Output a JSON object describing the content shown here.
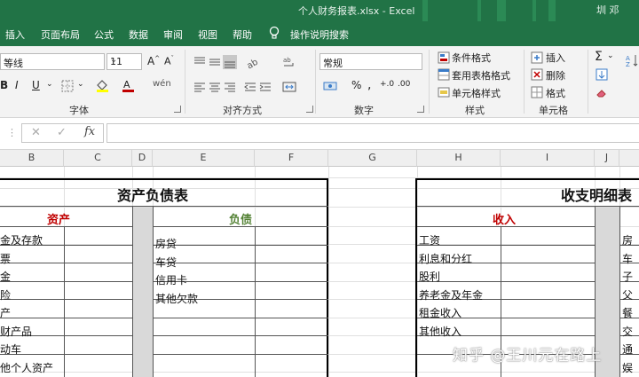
{
  "window": {
    "title": "个人财务报表.xlsx  -  Excel",
    "user": "圳 邓"
  },
  "tabs": [
    "插入",
    "页面布局",
    "公式",
    "数据",
    "审阅",
    "视图",
    "帮助"
  ],
  "tell_me": "操作说明搜索",
  "ribbon": {
    "font_name": "等线",
    "font_size": "11",
    "number_format": "常规",
    "styles": {
      "conditional": "条件格式",
      "as_table": "套用表格格式",
      "cell_styles": "单元格样式"
    },
    "cells_group": {
      "insert": "插入",
      "delete": "删除",
      "format": "格式"
    },
    "groups": {
      "font": "字体",
      "alignment": "对齐方式",
      "number": "数字",
      "styles": "样式",
      "cells": "单元格"
    },
    "colors": {
      "highlight": "#ffff00",
      "font_color": "#c00000",
      "brand": "#217346"
    }
  },
  "formula_bar": {
    "fx": "fx",
    "value": ""
  },
  "columns": [
    "B",
    "C",
    "D",
    "E",
    "F",
    "G",
    "H",
    "I",
    "J"
  ],
  "sheet": {
    "balance": {
      "title": "资产负债表",
      "assets_header": "资产",
      "liabilities_header": "负债",
      "assets": [
        "金及存款",
        "票",
        "金",
        "险",
        "产",
        "财产品",
        "动车",
        "他个人资产"
      ],
      "liabilities": [
        "房贷",
        "车贷",
        "信用卡",
        "其他欠款"
      ]
    },
    "income": {
      "title": "收支明细表",
      "income_header": "收入",
      "income_items": [
        "工资",
        "利息和分红",
        "股利",
        "养老金及年金",
        "租金收入",
        "其他收入"
      ],
      "expense_items": [
        "房",
        "车",
        "子",
        "父",
        "餐",
        "交",
        "通",
        "娱"
      ]
    },
    "colors": {
      "assets_header": "#c00000",
      "liabilities_header": "#548235",
      "income_header": "#c00000"
    }
  },
  "watermark": "知乎 @王川元在路上"
}
